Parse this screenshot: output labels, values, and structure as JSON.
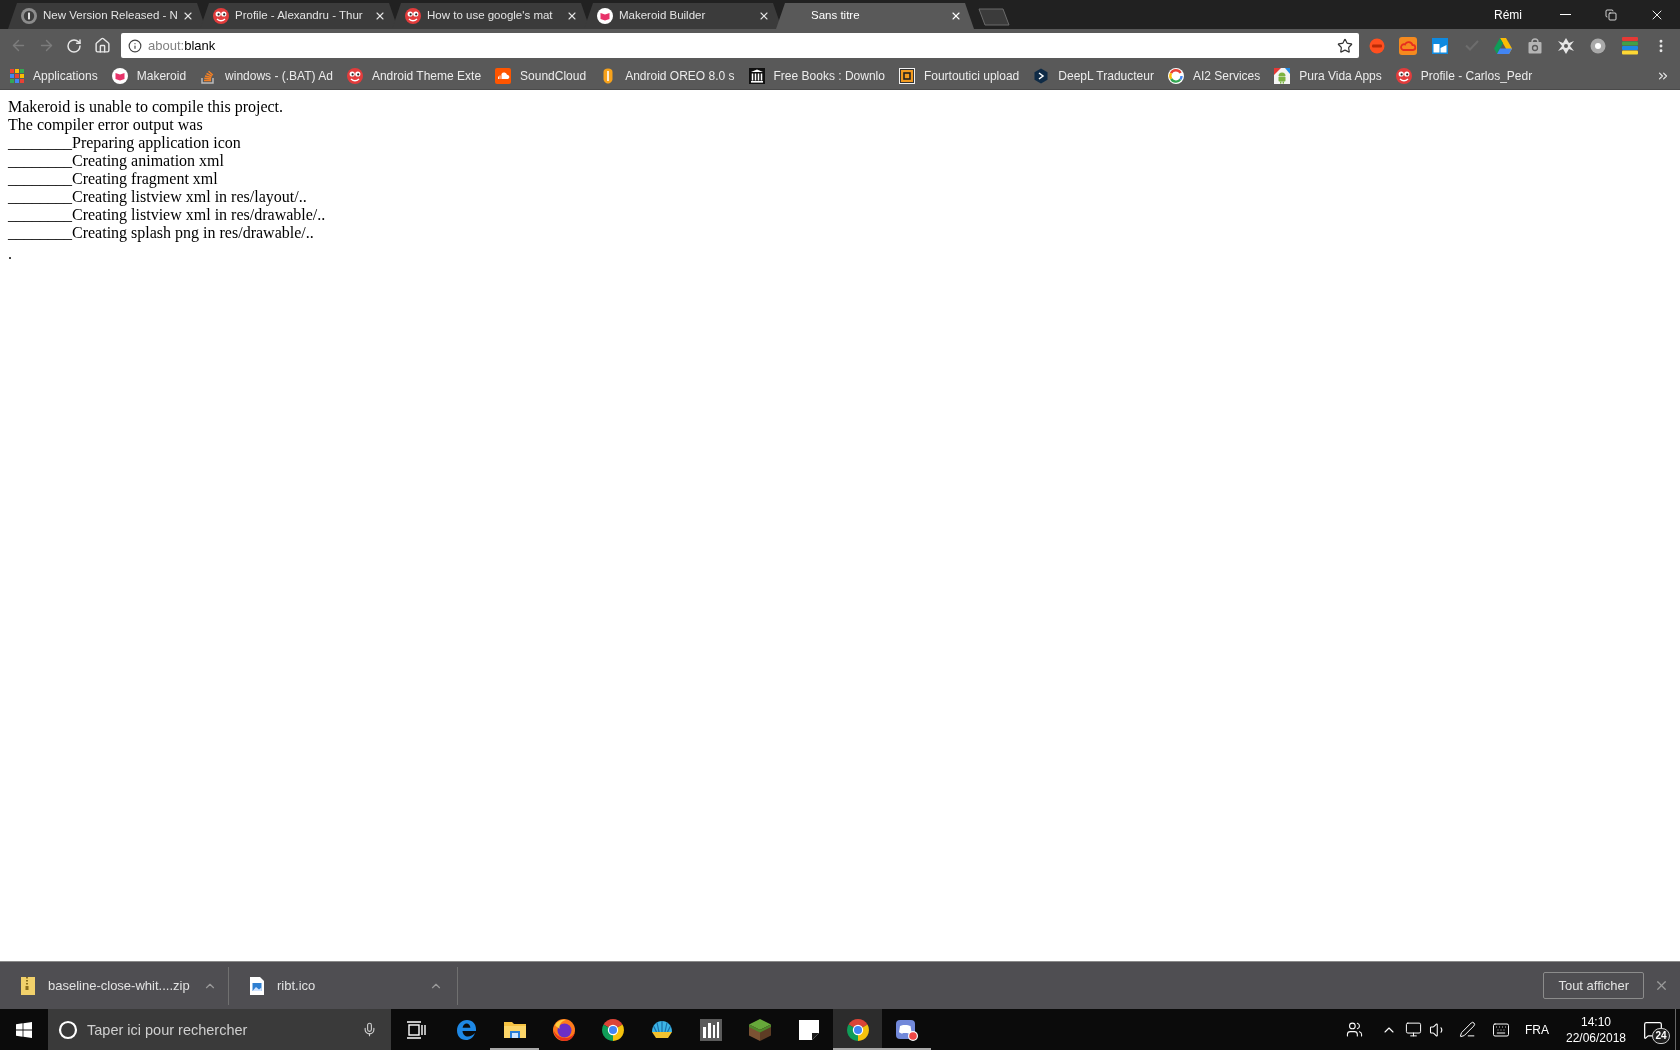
{
  "browser": {
    "tabs": [
      {
        "title": "New Version Released - N",
        "kind": "disc",
        "selected": false
      },
      {
        "title": "Profile - Alexandru - Thur",
        "kind": "creature",
        "selected": false
      },
      {
        "title": "How to use google's mat",
        "kind": "creature",
        "selected": false
      },
      {
        "title": "Makeroid Builder",
        "kind": "book",
        "selected": false
      },
      {
        "title": "Sans titre",
        "kind": "blank",
        "selected": true
      }
    ],
    "profile_name": "Rémi",
    "back": {
      "disabled": true
    },
    "forward": {
      "disabled": true
    },
    "address": {
      "scheme": "about:",
      "path": "blank"
    },
    "bookmarks": [
      {
        "label": "Applications",
        "kind": "grid"
      },
      {
        "label": "Makeroid",
        "kind": "book"
      },
      {
        "label": "windows - (.BAT) Ad",
        "kind": "stack"
      },
      {
        "label": "Android Theme Exte",
        "kind": "creature"
      },
      {
        "label": "SoundCloud",
        "kind": "cloud"
      },
      {
        "label": "Android OREO 8.0 s",
        "kind": "shield"
      },
      {
        "label": "Free Books : Downlo",
        "kind": "pillars"
      },
      {
        "label": "Fourtoutici upload",
        "kind": "frame"
      },
      {
        "label": "DeepL Traducteur",
        "kind": "hexagon"
      },
      {
        "label": "AI2 Services",
        "kind": "ring"
      },
      {
        "label": "Pura Vida Apps",
        "kind": "robot"
      },
      {
        "label": "Profile - Carlos_Pedr",
        "kind": "creature"
      }
    ]
  },
  "page": {
    "lines": [
      "Makeroid is unable to compile this project.",
      "The compiler error output was",
      "________Preparing application icon",
      "________Creating animation xml",
      "________Creating fragment xml",
      "________Creating listview xml in res/layout/..",
      "________Creating listview xml in res/drawable/..",
      "________Creating splash png in res/drawable/.."
    ],
    "end_mark": "."
  },
  "downloads_bar": {
    "items": [
      {
        "name": "baseline-close-whit....zip",
        "kind": "zip"
      },
      {
        "name": "ribt.ico",
        "kind": "image"
      }
    ],
    "show_all_button": "Tout afficher"
  },
  "taskbar": {
    "search_placeholder": "Taper ici pour rechercher",
    "apps": [
      {
        "kind": "swirl",
        "running": false,
        "selected": false
      },
      {
        "kind": "folder",
        "running": true,
        "selected": false
      },
      {
        "kind": "globe",
        "running": false,
        "selected": false
      },
      {
        "kind": "circle-logo",
        "running": false,
        "selected": false
      },
      {
        "kind": "shell",
        "running": false,
        "selected": false
      },
      {
        "kind": "tile",
        "running": false,
        "selected": false
      },
      {
        "kind": "cube",
        "running": false,
        "selected": false
      },
      {
        "kind": "note",
        "running": false,
        "selected": false
      },
      {
        "kind": "circle-logo",
        "running": true,
        "selected": true
      },
      {
        "kind": "chat",
        "running": true,
        "selected": false
      }
    ],
    "language": "FRA",
    "time": "14:10",
    "date": "22/06/2018",
    "notification_count": "24"
  }
}
